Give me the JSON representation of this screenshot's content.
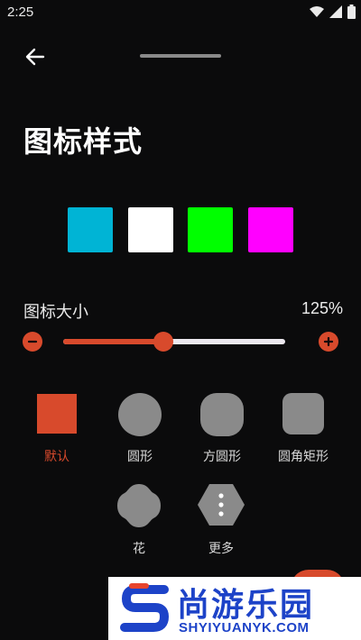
{
  "status_bar": {
    "time": "2:25",
    "icons": [
      "wifi-icon",
      "signal-icon",
      "battery-icon"
    ]
  },
  "header": {
    "back_icon": "arrow-left-icon",
    "title": "图标样式"
  },
  "colors": {
    "swatches": [
      "#00b4d5",
      "#ffffff",
      "#00ff00",
      "#ff00ff"
    ],
    "accent": "#d84a2c"
  },
  "icon_size": {
    "label": "图标大小",
    "value_text": "125%",
    "level": 0.45,
    "minus_icon": "minus-icon",
    "plus_icon": "plus-icon"
  },
  "shapes": [
    {
      "label": "默认",
      "selected": true
    },
    {
      "label": "圆形",
      "selected": false
    },
    {
      "label": "方圆形",
      "selected": false
    },
    {
      "label": "圆角矩形",
      "selected": false
    },
    {
      "label": "花",
      "selected": false
    },
    {
      "label": "更多",
      "selected": false
    }
  ],
  "watermark": {
    "name": "尚游乐园",
    "url": "SHYIYUANYK.COM"
  }
}
